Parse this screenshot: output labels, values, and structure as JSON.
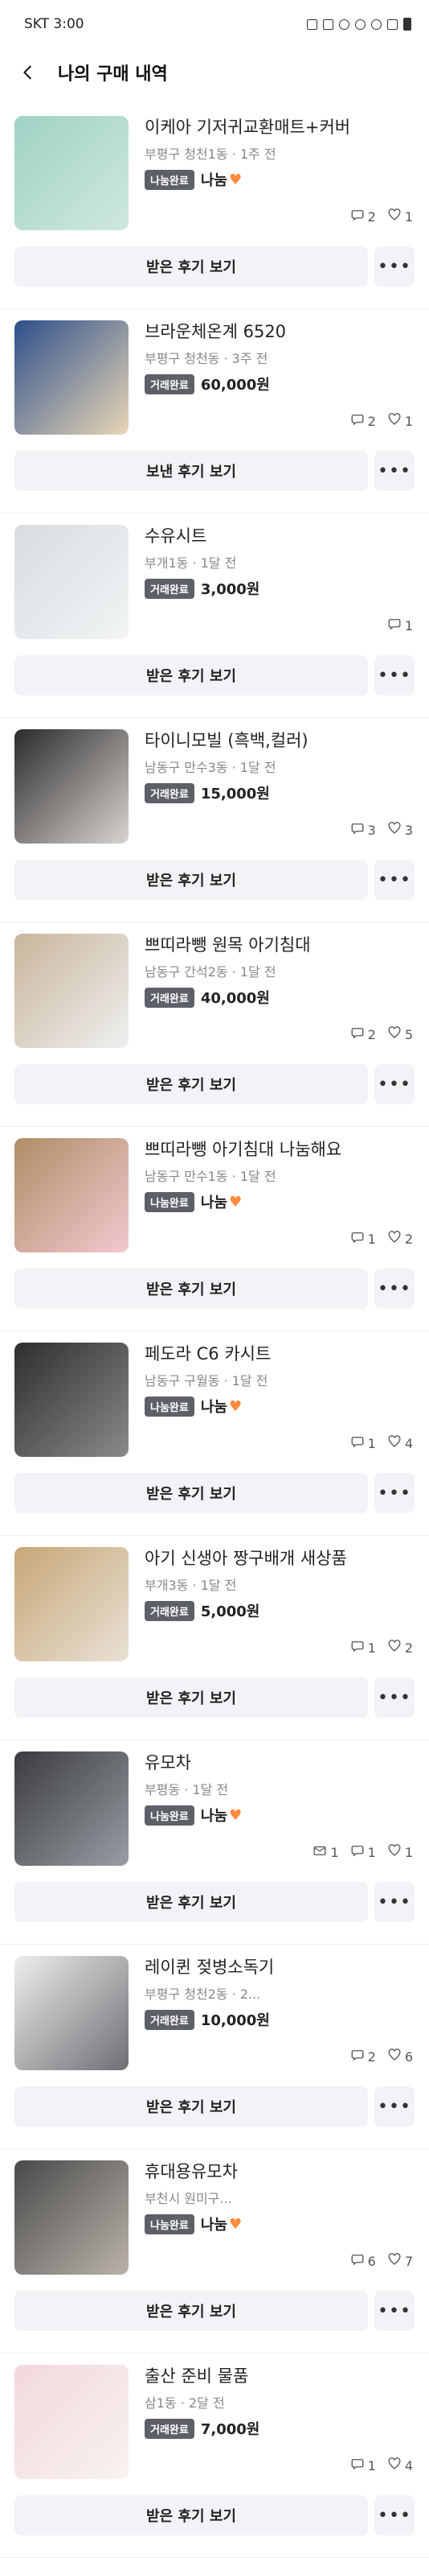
{
  "statusbar": {
    "carrier_time": "SKT 3:00"
  },
  "header": {
    "title": "나의 구매 내역"
  },
  "items": [
    {
      "name": "이케아 기저귀교환매트+커버",
      "meta": "부평구 청천1동 · 1주 전",
      "badge": "나눔완료",
      "price": "나눔",
      "free": true,
      "chat": "2",
      "like": "1",
      "mail": "",
      "review": "받은 후기 보기",
      "thumb": [
        "#9fd2c4",
        "#cfe8df"
      ]
    },
    {
      "name": "브라운체온계 6520",
      "meta": "부평구 청천동 · 3주 전",
      "badge": "거래완료",
      "price": "60,000원",
      "free": false,
      "chat": "2",
      "like": "1",
      "mail": "",
      "review": "보낸 후기 보기",
      "thumb": [
        "#2d4f8a",
        "#e9d7b7"
      ]
    },
    {
      "name": "수유시트",
      "meta": "부개1동 · 1달 전",
      "badge": "거래완료",
      "price": "3,000원",
      "free": false,
      "chat": "1",
      "like": "",
      "mail": "",
      "review": "받은 후기 보기",
      "thumb": [
        "#d8dde0",
        "#f2f4f5"
      ]
    },
    {
      "name": "타이니모빌 (흑백,컬러)",
      "meta": "남동구 만수3동 · 1달 전",
      "badge": "거래완료",
      "price": "15,000원",
      "free": false,
      "chat": "3",
      "like": "3",
      "mail": "",
      "review": "받은 후기 보기",
      "thumb": [
        "#2b2b2b",
        "#d9d4d0"
      ]
    },
    {
      "name": "쁘띠라뺑 원목 아기침대",
      "meta": "남동구 간석2동 · 1달 전",
      "badge": "거래완료",
      "price": "40,000원",
      "free": false,
      "chat": "2",
      "like": "5",
      "mail": "",
      "review": "받은 후기 보기",
      "thumb": [
        "#c9b59b",
        "#eef0f0"
      ]
    },
    {
      "name": "쁘띠라뺑 아기침대 나눔해요",
      "meta": "남동구 만수1동 · 1달 전",
      "badge": "나눔완료",
      "price": "나눔",
      "free": true,
      "chat": "1",
      "like": "2",
      "mail": "",
      "review": "받은 후기 보기",
      "thumb": [
        "#b08c66",
        "#f1c9cf"
      ]
    },
    {
      "name": "페도라 C6 카시트",
      "meta": "남동구 구월동 · 1달 전",
      "badge": "나눔완료",
      "price": "나눔",
      "free": true,
      "chat": "1",
      "like": "4",
      "mail": "",
      "review": "받은 후기 보기",
      "thumb": [
        "#2e2e30",
        "#8a8a8c"
      ]
    },
    {
      "name": "아기 신생아 짱구배개 새상품",
      "meta": "부개3동 · 1달 전",
      "badge": "거래완료",
      "price": "5,000원",
      "free": false,
      "chat": "1",
      "like": "2",
      "mail": "",
      "review": "받은 후기 보기",
      "thumb": [
        "#c7a777",
        "#e9e1d6"
      ]
    },
    {
      "name": "유모차",
      "meta": "부평동 · 1달 전",
      "badge": "나눔완료",
      "price": "나눔",
      "free": true,
      "chat": "1",
      "like": "1",
      "mail": "1",
      "review": "받은 후기 보기",
      "thumb": [
        "#3a3c40",
        "#9a9da3"
      ]
    },
    {
      "name": "레이퀸 젖병소독기",
      "meta": "부평구 청천2동 · 2...",
      "badge": "거래완료",
      "price": "10,000원",
      "free": false,
      "chat": "2",
      "like": "6",
      "mail": "",
      "review": "받은 후기 보기",
      "thumb": [
        "#eeeeee",
        "#6d6f73"
      ]
    },
    {
      "name": "휴대용유모차",
      "meta": "부천시 원미구...",
      "badge": "나눔완료",
      "price": "나눔",
      "free": true,
      "chat": "6",
      "like": "7",
      "mail": "",
      "review": "받은 후기 보기",
      "thumb": [
        "#4a4a4a",
        "#b9b3aa"
      ]
    },
    {
      "name": "출산 준비 물품",
      "meta": "삼1동 · 2달 전",
      "badge": "거래완료",
      "price": "7,000원",
      "free": false,
      "chat": "1",
      "like": "4",
      "mail": "",
      "review": "받은 후기 보기",
      "thumb": [
        "#f3d8dc",
        "#f7f3ee"
      ]
    }
  ],
  "colors": {
    "badge": "#5d6067",
    "button_bg": "#f2f3f6",
    "accent": "#ff8a3d"
  }
}
